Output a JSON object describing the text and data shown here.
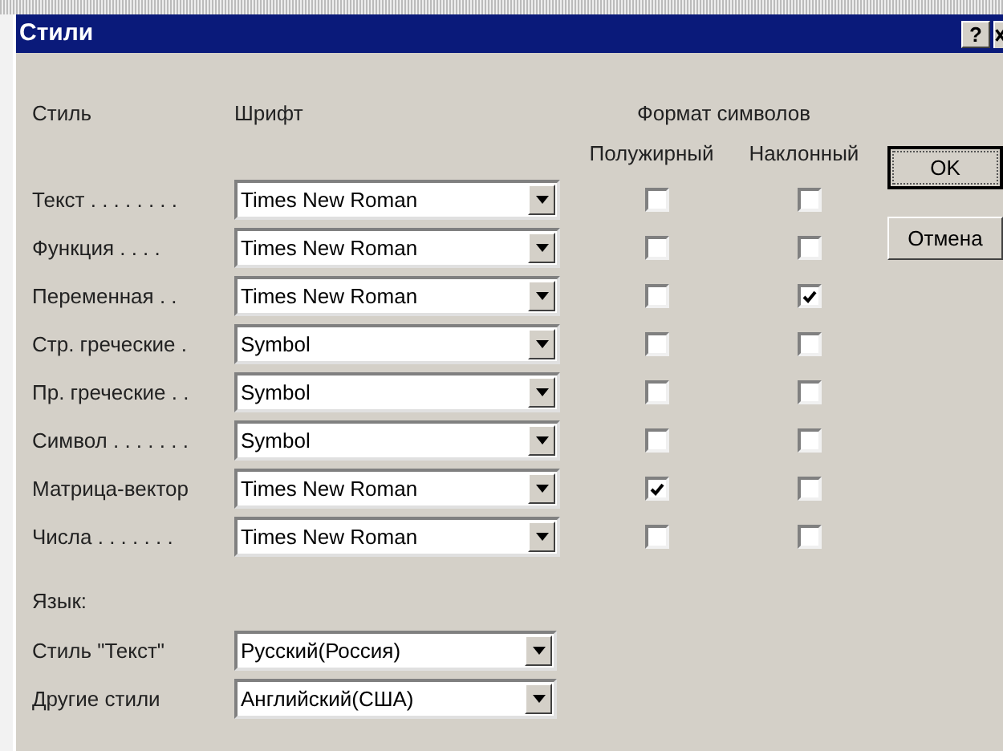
{
  "window": {
    "title": "Стили",
    "help": "?"
  },
  "headers": {
    "style": "Стиль",
    "font": "Шрифт",
    "format": "Формат символов",
    "bold": "Полужирный",
    "italic": "Наклонный"
  },
  "rows": [
    {
      "label": "Текст . . . . . . . .",
      "font": "Times New Roman",
      "bold": false,
      "italic": false
    },
    {
      "label": "Функция . . . .",
      "font": "Times New Roman",
      "bold": false,
      "italic": false
    },
    {
      "label": "Переменная . .",
      "font": "Times New Roman",
      "bold": false,
      "italic": true
    },
    {
      "label": "Стр. греческие .",
      "font": "Symbol",
      "bold": false,
      "italic": false
    },
    {
      "label": "Пр. греческие . .",
      "font": "Symbol",
      "bold": false,
      "italic": false
    },
    {
      "label": "Символ . . . . . . .",
      "font": "Symbol",
      "bold": false,
      "italic": false
    },
    {
      "label": "Матрица-вектор",
      "font": "Times New Roman",
      "bold": true,
      "italic": false
    },
    {
      "label": "Числа . . . . . . .",
      "font": "Times New Roman",
      "bold": false,
      "italic": false
    }
  ],
  "language": {
    "title": "Язык:",
    "rows": [
      {
        "label": "Стиль \"Текст\"",
        "value": "Русский(Россия)"
      },
      {
        "label": "Другие стили",
        "value": "Английский(США)"
      }
    ]
  },
  "buttons": [
    {
      "label": "OK",
      "default": true
    },
    {
      "label": "Отмена",
      "default": false
    }
  ]
}
